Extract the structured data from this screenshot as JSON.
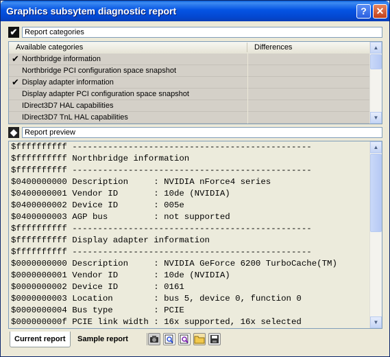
{
  "window": {
    "title": "Graphics subsytem diagnostic report",
    "help_glyph": "?",
    "close_glyph": "✕"
  },
  "categories": {
    "header_label": "Report categories",
    "checkbox_glyph": "✔",
    "col_available": "Available categories",
    "col_differences": "Differences",
    "items": [
      {
        "label": "Northbridge information",
        "checked": true
      },
      {
        "label": "Northbridge PCI configuration space snapshot",
        "checked": false
      },
      {
        "label": "Display adapter information",
        "checked": true
      },
      {
        "label": "Display adapter PCI configuration space snapshot",
        "checked": false
      },
      {
        "label": "IDirect3D7 HAL capabilities",
        "checked": false
      },
      {
        "label": "IDirect3D7 TnL HAL capabilities",
        "checked": false
      }
    ]
  },
  "preview": {
    "header_label": "Report preview",
    "icon_glyph": "◆",
    "lines": [
      "$ffffffffff -----------------------------------------------",
      "$ffffffffff Northbridge information",
      "$ffffffffff -----------------------------------------------",
      "$0400000000 Description     : NVIDIA nForce4 series",
      "$0400000001 Vendor ID       : 10de (NVIDIA)",
      "$0400000002 Device ID       : 005e",
      "$0400000003 AGP bus         : not supported",
      "$ffffffffff -----------------------------------------------",
      "$ffffffffff Display adapter information",
      "$ffffffffff -----------------------------------------------",
      "$0000000000 Description     : NVIDIA GeForce 6200 TurboCache(TM)",
      "$0000000001 Vendor ID       : 10de (NVIDIA)",
      "$0000000002 Device ID       : 0161",
      "$0000000003 Location        : bus 5, device 0, function 0",
      "$0000000004 Bus type        : PCIE",
      "$000000000f PCIE link width : 16x supported, 16x selected"
    ]
  },
  "tabs": {
    "current": "Current report",
    "sample": "Sample report"
  },
  "toolbar": {
    "icons": [
      "camera-icon",
      "preview-report-icon",
      "compare-report-icon",
      "open-folder-icon",
      "save-disk-icon"
    ]
  },
  "scroll": {
    "up": "▲",
    "down": "▼"
  }
}
